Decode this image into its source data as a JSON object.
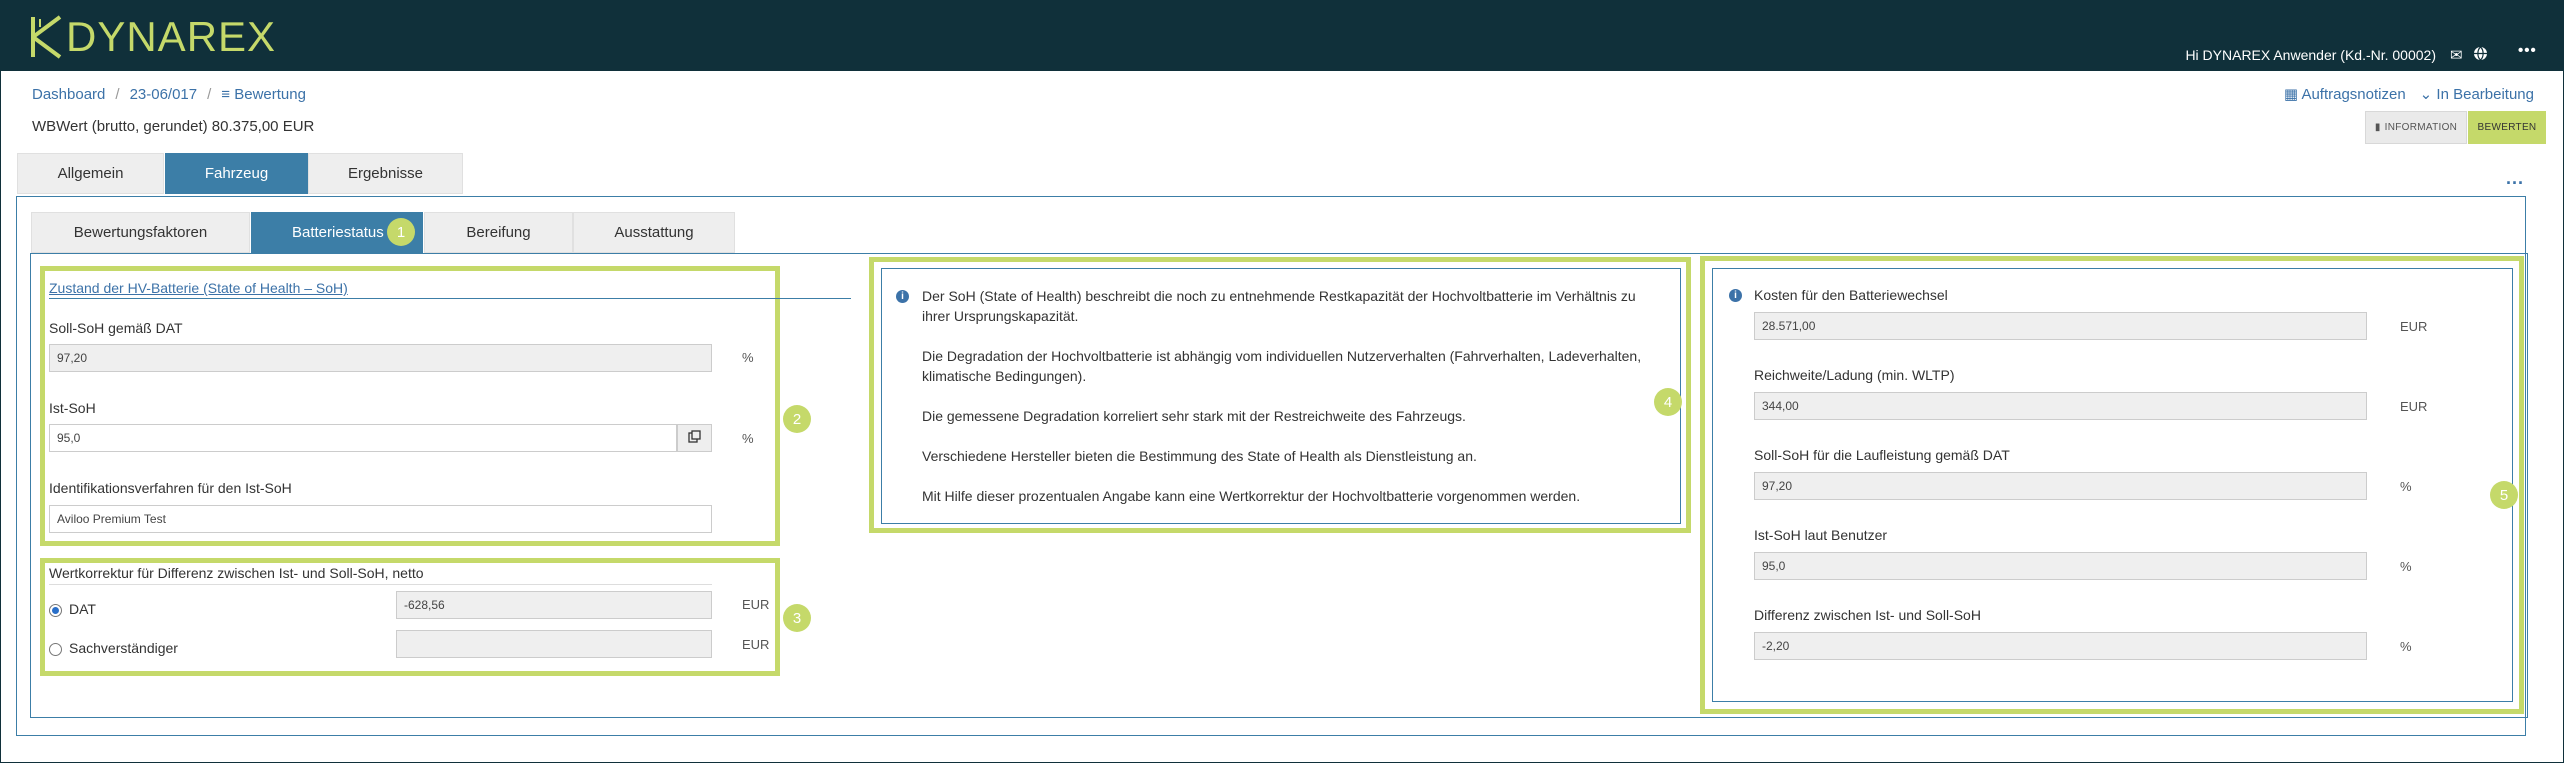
{
  "app": {
    "logo_text": "DYNAREX",
    "greeting": "Hi DYNAREX Anwender (Kd.-Nr. 00002)"
  },
  "breadcrumb": {
    "items": [
      "Dashboard",
      "23-06/017",
      "Bewertung"
    ]
  },
  "wbwert": {
    "label": "WBWert (brutto, gerundet)",
    "value": "80.375,00",
    "unit": "EUR"
  },
  "header_links": {
    "notes": "Auftragsnotizen",
    "status": "In Bearbeitung"
  },
  "buttons": {
    "information": "INFORMATION",
    "bewerten": "BEWERTEN",
    "more": "..."
  },
  "main_tabs": [
    "Allgemein",
    "Fahrzeug",
    "Ergebnisse"
  ],
  "sub_tabs": [
    "Bewertungsfaktoren",
    "Batteriestatus",
    "Bereifung",
    "Ausstattung"
  ],
  "badges": [
    "1",
    "2",
    "3",
    "4",
    "5"
  ],
  "soh_section": {
    "title": "Zustand der HV-Batterie (State of Health – SoH)",
    "soll_label": "Soll-SoH gemäß DAT",
    "soll_value": "97,20",
    "ist_label": "Ist-SoH",
    "ist_value": "95,0",
    "ident_label": "Identifikationsverfahren für den Ist-SoH",
    "ident_value": "Aviloo Premium Test",
    "percent": "%"
  },
  "wertkorrektur": {
    "title": "Wertkorrektur für Differenz zwischen Ist- und Soll-SoH, netto",
    "dat_label": "DAT",
    "dat_value": "-628,56",
    "sv_label": "Sachverständiger",
    "sv_value": "",
    "unit": "EUR"
  },
  "info_text": [
    "Der SoH (State of Health) beschreibt die noch zu entnehmende Restkapazität der Hochvoltbatterie im Verhältnis zu ihrer Ursprungskapazität.",
    "Die Degradation der Hochvoltbatterie ist abhängig vom individuellen Nutzerverhalten (Fahrverhalten, Ladeverhalten, klimatische Bedingungen).",
    "Die gemessene Degradation korreliert sehr stark mit der Restreichweite des Fahrzeugs.",
    "Verschiedene Hersteller bieten die Bestimmung des State of Health als Dienstleistung an.",
    "Mit Hilfe dieser prozentualen Angabe kann eine Wertkorrektur der Hochvoltbatterie vorgenommen werden."
  ],
  "right_panel": {
    "kosten_label": "Kosten für den Batteriewechsel",
    "kosten_value": "28.571,00",
    "kosten_unit": "EUR",
    "reichweite_label": "Reichweite/Ladung (min. WLTP)",
    "reichweite_value": "344,00",
    "reichweite_unit": "EUR",
    "sollsoh_label": "Soll-SoH für die Laufleistung gemäß DAT",
    "sollsoh_value": "97,20",
    "sollsoh_unit": "%",
    "istsoh_label": "Ist-SoH laut Benutzer",
    "istsoh_value": "95,0",
    "istsoh_unit": "%",
    "diff_label": "Differenz zwischen Ist- und Soll-SoH",
    "diff_value": "-2,20",
    "diff_unit": "%"
  },
  "colors": {
    "topbar": "#10303a",
    "accent_green": "#c5d96a",
    "accent_blue": "#3c7ea7",
    "link": "#3c72a8"
  }
}
